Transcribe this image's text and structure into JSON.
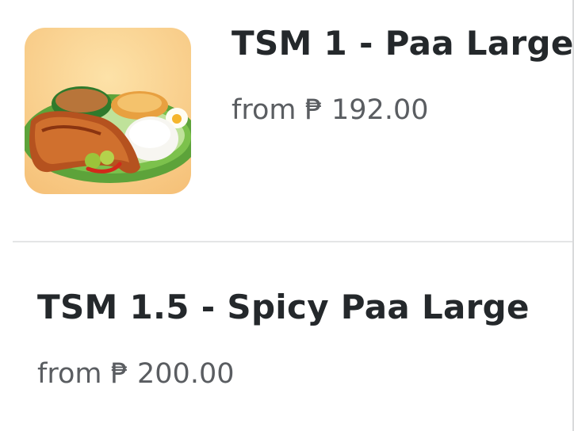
{
  "menu_items": [
    {
      "title": "TSM 1 - Paa Large",
      "price_prefix": "from",
      "currency": "₱",
      "price": "192.00",
      "image_icon": "inasal-meal-image"
    },
    {
      "title": "TSM 1.5 - Spicy Paa Large",
      "price_prefix": "from",
      "currency": "₱",
      "price": "200.00"
    }
  ]
}
